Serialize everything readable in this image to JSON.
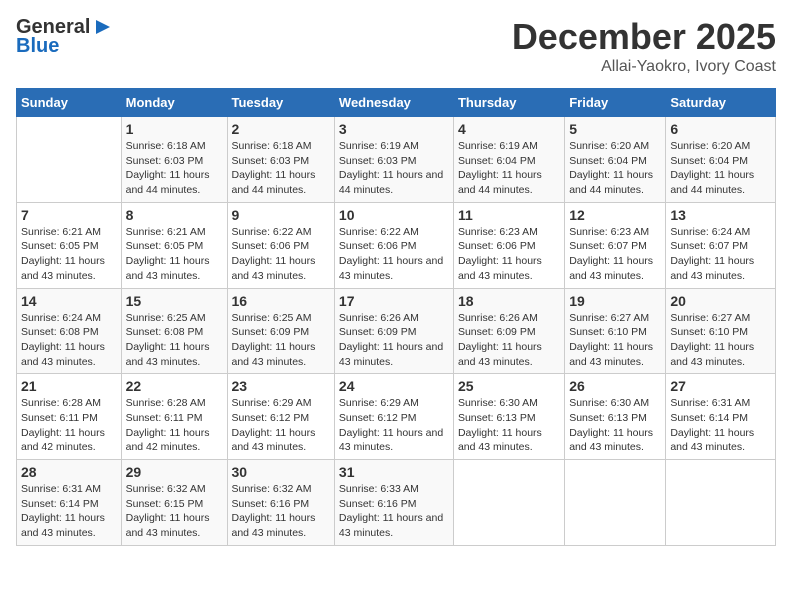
{
  "logo": {
    "general": "General",
    "blue": "Blue",
    "arrow": "►"
  },
  "title": "December 2025",
  "subtitle": "Allai-Yaokro, Ivory Coast",
  "days_of_week": [
    "Sunday",
    "Monday",
    "Tuesday",
    "Wednesday",
    "Thursday",
    "Friday",
    "Saturday"
  ],
  "weeks": [
    [
      {
        "day": "",
        "sunrise": "",
        "sunset": "",
        "daylight": ""
      },
      {
        "day": "1",
        "sunrise": "Sunrise: 6:18 AM",
        "sunset": "Sunset: 6:03 PM",
        "daylight": "Daylight: 11 hours and 44 minutes."
      },
      {
        "day": "2",
        "sunrise": "Sunrise: 6:18 AM",
        "sunset": "Sunset: 6:03 PM",
        "daylight": "Daylight: 11 hours and 44 minutes."
      },
      {
        "day": "3",
        "sunrise": "Sunrise: 6:19 AM",
        "sunset": "Sunset: 6:03 PM",
        "daylight": "Daylight: 11 hours and 44 minutes."
      },
      {
        "day": "4",
        "sunrise": "Sunrise: 6:19 AM",
        "sunset": "Sunset: 6:04 PM",
        "daylight": "Daylight: 11 hours and 44 minutes."
      },
      {
        "day": "5",
        "sunrise": "Sunrise: 6:20 AM",
        "sunset": "Sunset: 6:04 PM",
        "daylight": "Daylight: 11 hours and 44 minutes."
      },
      {
        "day": "6",
        "sunrise": "Sunrise: 6:20 AM",
        "sunset": "Sunset: 6:04 PM",
        "daylight": "Daylight: 11 hours and 44 minutes."
      }
    ],
    [
      {
        "day": "7",
        "sunrise": "Sunrise: 6:21 AM",
        "sunset": "Sunset: 6:05 PM",
        "daylight": "Daylight: 11 hours and 43 minutes."
      },
      {
        "day": "8",
        "sunrise": "Sunrise: 6:21 AM",
        "sunset": "Sunset: 6:05 PM",
        "daylight": "Daylight: 11 hours and 43 minutes."
      },
      {
        "day": "9",
        "sunrise": "Sunrise: 6:22 AM",
        "sunset": "Sunset: 6:06 PM",
        "daylight": "Daylight: 11 hours and 43 minutes."
      },
      {
        "day": "10",
        "sunrise": "Sunrise: 6:22 AM",
        "sunset": "Sunset: 6:06 PM",
        "daylight": "Daylight: 11 hours and 43 minutes."
      },
      {
        "day": "11",
        "sunrise": "Sunrise: 6:23 AM",
        "sunset": "Sunset: 6:06 PM",
        "daylight": "Daylight: 11 hours and 43 minutes."
      },
      {
        "day": "12",
        "sunrise": "Sunrise: 6:23 AM",
        "sunset": "Sunset: 6:07 PM",
        "daylight": "Daylight: 11 hours and 43 minutes."
      },
      {
        "day": "13",
        "sunrise": "Sunrise: 6:24 AM",
        "sunset": "Sunset: 6:07 PM",
        "daylight": "Daylight: 11 hours and 43 minutes."
      }
    ],
    [
      {
        "day": "14",
        "sunrise": "Sunrise: 6:24 AM",
        "sunset": "Sunset: 6:08 PM",
        "daylight": "Daylight: 11 hours and 43 minutes."
      },
      {
        "day": "15",
        "sunrise": "Sunrise: 6:25 AM",
        "sunset": "Sunset: 6:08 PM",
        "daylight": "Daylight: 11 hours and 43 minutes."
      },
      {
        "day": "16",
        "sunrise": "Sunrise: 6:25 AM",
        "sunset": "Sunset: 6:09 PM",
        "daylight": "Daylight: 11 hours and 43 minutes."
      },
      {
        "day": "17",
        "sunrise": "Sunrise: 6:26 AM",
        "sunset": "Sunset: 6:09 PM",
        "daylight": "Daylight: 11 hours and 43 minutes."
      },
      {
        "day": "18",
        "sunrise": "Sunrise: 6:26 AM",
        "sunset": "Sunset: 6:09 PM",
        "daylight": "Daylight: 11 hours and 43 minutes."
      },
      {
        "day": "19",
        "sunrise": "Sunrise: 6:27 AM",
        "sunset": "Sunset: 6:10 PM",
        "daylight": "Daylight: 11 hours and 43 minutes."
      },
      {
        "day": "20",
        "sunrise": "Sunrise: 6:27 AM",
        "sunset": "Sunset: 6:10 PM",
        "daylight": "Daylight: 11 hours and 43 minutes."
      }
    ],
    [
      {
        "day": "21",
        "sunrise": "Sunrise: 6:28 AM",
        "sunset": "Sunset: 6:11 PM",
        "daylight": "Daylight: 11 hours and 42 minutes."
      },
      {
        "day": "22",
        "sunrise": "Sunrise: 6:28 AM",
        "sunset": "Sunset: 6:11 PM",
        "daylight": "Daylight: 11 hours and 42 minutes."
      },
      {
        "day": "23",
        "sunrise": "Sunrise: 6:29 AM",
        "sunset": "Sunset: 6:12 PM",
        "daylight": "Daylight: 11 hours and 43 minutes."
      },
      {
        "day": "24",
        "sunrise": "Sunrise: 6:29 AM",
        "sunset": "Sunset: 6:12 PM",
        "daylight": "Daylight: 11 hours and 43 minutes."
      },
      {
        "day": "25",
        "sunrise": "Sunrise: 6:30 AM",
        "sunset": "Sunset: 6:13 PM",
        "daylight": "Daylight: 11 hours and 43 minutes."
      },
      {
        "day": "26",
        "sunrise": "Sunrise: 6:30 AM",
        "sunset": "Sunset: 6:13 PM",
        "daylight": "Daylight: 11 hours and 43 minutes."
      },
      {
        "day": "27",
        "sunrise": "Sunrise: 6:31 AM",
        "sunset": "Sunset: 6:14 PM",
        "daylight": "Daylight: 11 hours and 43 minutes."
      }
    ],
    [
      {
        "day": "28",
        "sunrise": "Sunrise: 6:31 AM",
        "sunset": "Sunset: 6:14 PM",
        "daylight": "Daylight: 11 hours and 43 minutes."
      },
      {
        "day": "29",
        "sunrise": "Sunrise: 6:32 AM",
        "sunset": "Sunset: 6:15 PM",
        "daylight": "Daylight: 11 hours and 43 minutes."
      },
      {
        "day": "30",
        "sunrise": "Sunrise: 6:32 AM",
        "sunset": "Sunset: 6:16 PM",
        "daylight": "Daylight: 11 hours and 43 minutes."
      },
      {
        "day": "31",
        "sunrise": "Sunrise: 6:33 AM",
        "sunset": "Sunset: 6:16 PM",
        "daylight": "Daylight: 11 hours and 43 minutes."
      },
      {
        "day": "",
        "sunrise": "",
        "sunset": "",
        "daylight": ""
      },
      {
        "day": "",
        "sunrise": "",
        "sunset": "",
        "daylight": ""
      },
      {
        "day": "",
        "sunrise": "",
        "sunset": "",
        "daylight": ""
      }
    ]
  ]
}
